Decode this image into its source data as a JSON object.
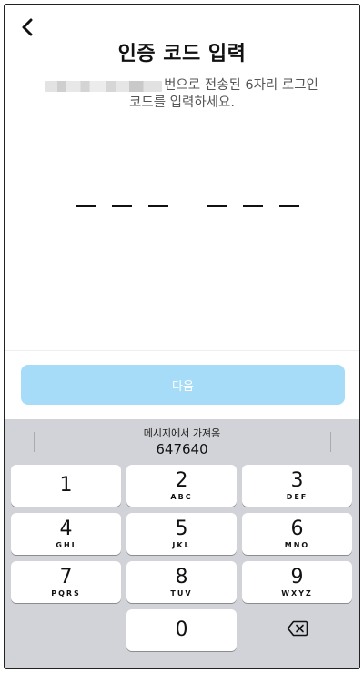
{
  "header": {
    "title": "인증 코드 입력",
    "description_line1_suffix": "번으로 전송된 6자리 로그인",
    "description_line2": "코드를 입력하세요."
  },
  "code_input": {
    "digits": [
      "",
      "",
      "",
      "",
      "",
      ""
    ]
  },
  "next_button": {
    "label": "다음",
    "enabled": false
  },
  "keyboard": {
    "suggestion": {
      "source": "메시지에서 가져옴",
      "code": "647640"
    },
    "keys": [
      {
        "num": "1",
        "letters": ""
      },
      {
        "num": "2",
        "letters": "ABC"
      },
      {
        "num": "3",
        "letters": "DEF"
      },
      {
        "num": "4",
        "letters": "GHI"
      },
      {
        "num": "5",
        "letters": "JKL"
      },
      {
        "num": "6",
        "letters": "MNO"
      },
      {
        "num": "7",
        "letters": "PQRS"
      },
      {
        "num": "8",
        "letters": "TUV"
      },
      {
        "num": "9",
        "letters": "WXYZ"
      },
      {
        "num": "0",
        "letters": ""
      }
    ]
  },
  "colors": {
    "accent_disabled": "#a6dcf7",
    "keyboard_bg": "#d1d3d8"
  },
  "icons": {
    "back": "chevron-left-icon",
    "delete": "backspace-icon"
  }
}
